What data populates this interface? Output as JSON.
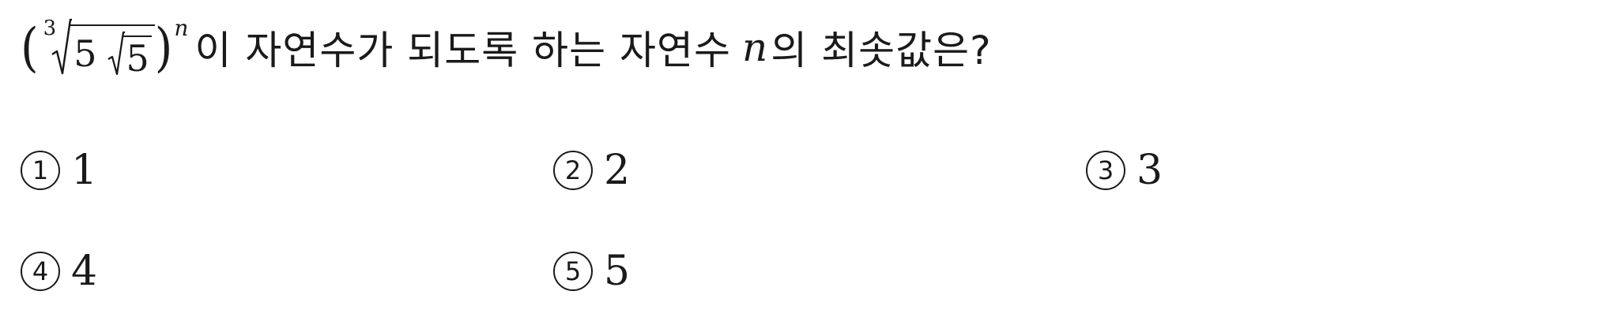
{
  "question": {
    "expression": {
      "root_index": "3",
      "outer_radicand": "5",
      "inner_radicand": "5",
      "exponent": "n"
    },
    "text_part1": "이 자연수가 되도록 하는 자연수",
    "variable": "n",
    "text_part2": "의 최솟값은?"
  },
  "choices": [
    {
      "number": "1",
      "value": "1"
    },
    {
      "number": "2",
      "value": "2"
    },
    {
      "number": "3",
      "value": "3"
    },
    {
      "number": "4",
      "value": "4"
    },
    {
      "number": "5",
      "value": "5"
    }
  ]
}
